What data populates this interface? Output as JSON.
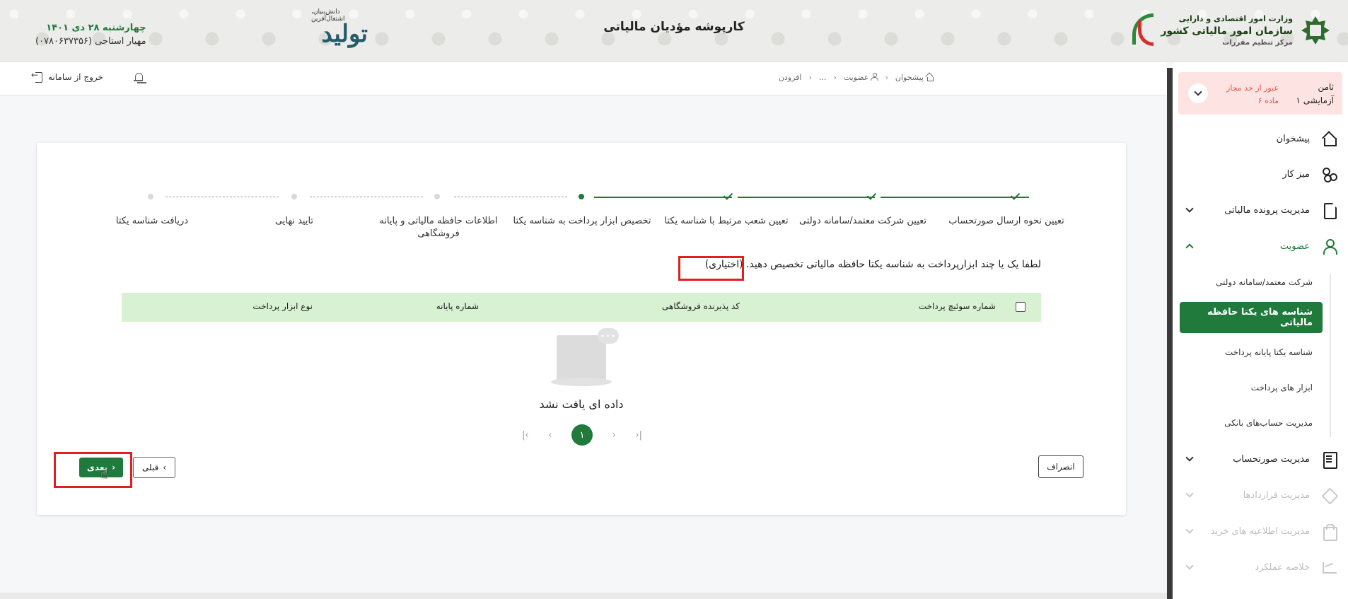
{
  "banner": {
    "title": "کارپوشه مؤدیان مالیاتی",
    "org_line1": "وزارت امور اقتصادی و دارایی",
    "org_line2": "سازمان امور مالیاتی کشور",
    "org_line3": "مرکز تنظیم مقررات",
    "tolid_big": "تولید",
    "tolid_small": "دانش‌بنیان، اشتغال‌آفرین",
    "date": "چهارشنبه ۲۸ دی ۱۴۰۱",
    "user": "مهیار استاجی (۰۷۸۰۶۳۷۳۵۶)"
  },
  "header": {
    "logout_label": "خروج از سامانه",
    "breadcrumb": [
      "پیشخوان",
      "عضویت",
      "...",
      "افزودن"
    ]
  },
  "sidebar": {
    "alert": {
      "name_line1": "ثامن",
      "name_line2": "آزمایشی ۱",
      "warn_line1": "عبور از حد مجاز",
      "warn_line2": "ماده ۶"
    },
    "items": [
      {
        "label": "پیشخوان",
        "icon": "home-icon"
      },
      {
        "label": "میز کار",
        "icon": "desk-icon"
      },
      {
        "label": "مدیریت پرونده مالیاتی",
        "icon": "file-icon"
      },
      {
        "label": "عضویت",
        "icon": "user-icon"
      },
      {
        "label": "مدیریت صورتحساب",
        "icon": "invoice-icon"
      },
      {
        "label": "مدیریت قراردادها",
        "icon": "contract-icon"
      },
      {
        "label": "مدیریت اطلاعیه های خرید",
        "icon": "bag-icon"
      },
      {
        "label": "خلاصه عملکرد",
        "icon": "chart-icon"
      }
    ],
    "sub_items": [
      {
        "label": "شرکت معتمد/سامانه دولتی"
      },
      {
        "label": "شناسه های یکتا حافظه مالیاتی"
      },
      {
        "label": "شناسه یکتا پایانه پرداخت"
      },
      {
        "label": "ابزار های پرداخت"
      },
      {
        "label": "مدیریت حساب‌های بانکی"
      }
    ]
  },
  "stepper": {
    "steps": [
      {
        "label": "تعیین نحوه ارسال صورتحساب",
        "status": "done"
      },
      {
        "label": "تعیین شرکت معتمد/سامانه دولتی",
        "status": "done"
      },
      {
        "label": "تعیین شعب مرتبط با شناسه یکتا",
        "status": "done"
      },
      {
        "label": "تخصیص ابزار پرداخت به شناسه یکتا",
        "status": "current"
      },
      {
        "label": "اطلاعات حافظه مالیاتی و پایانه فروشگاهی",
        "status": "pending"
      },
      {
        "label": "تایید نهایی",
        "status": "pending"
      },
      {
        "label": "دریافت شناسه یکتا",
        "status": "pending"
      }
    ]
  },
  "main": {
    "instruction": "لطفا یک یا چند ابزارپرداخت به شناسه یکتا حافظه مالیاتی تخصیص دهید. (اختیاری)",
    "columns": [
      "شماره سوئیچ پرداخت",
      "کد پذیرنده فروشگاهی",
      "شماره پایانه",
      "نوع ابزار پرداخت"
    ],
    "empty_text": "داده ای یافت نشد",
    "page": "۱",
    "cancel_label": "انصراف",
    "prev_label": "قبلی",
    "next_label": "بعدی"
  },
  "colors": {
    "primary": "#1f7a3b",
    "highlight": "#e0201f",
    "table_header": "#d9f1d3",
    "alert_bg": "#fde3e1"
  }
}
